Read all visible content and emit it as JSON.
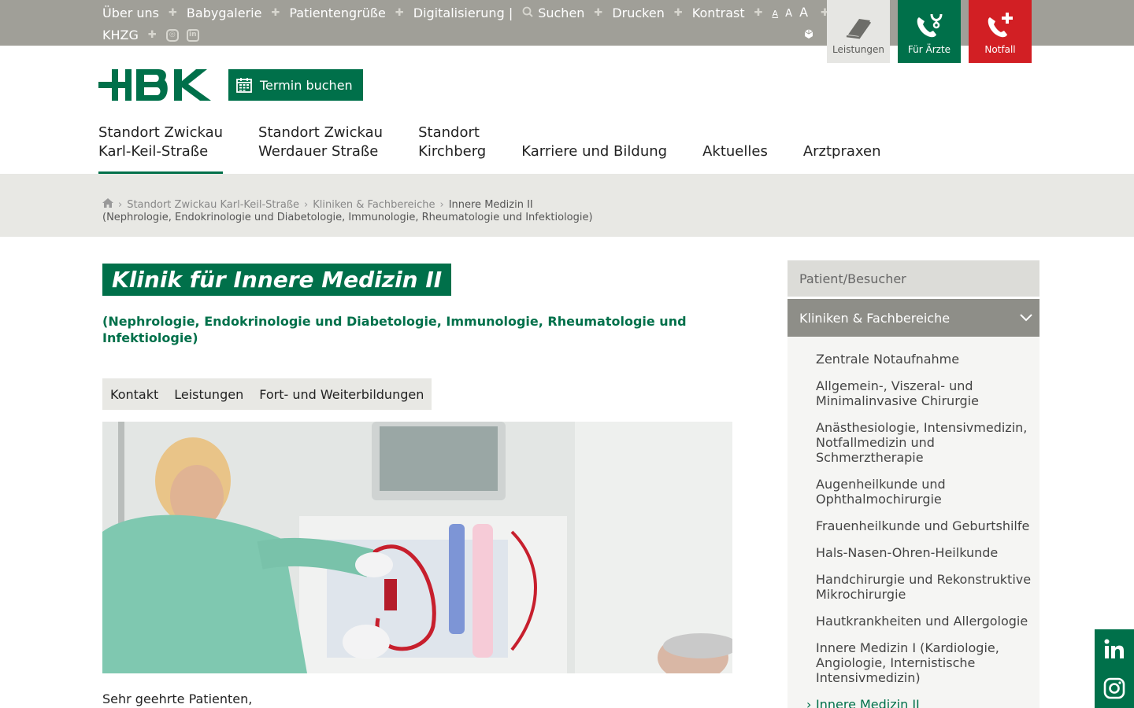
{
  "colors": {
    "brand_green": "#00704a",
    "emergency_red": "#d21f24",
    "topbar_gray": "#a09f98"
  },
  "topbar": {
    "links_row1": [
      "Über uns",
      "Babygalerie",
      "Patientengrüße",
      "Digitalisierung |"
    ],
    "search_label": "Suchen",
    "print_label": "Drucken",
    "contrast_label": "Kontrast",
    "fontsizes": [
      "A",
      "A",
      "A"
    ],
    "link_row2": "KHZG"
  },
  "quick_buttons": {
    "leistungen": "Leistungen",
    "aerzte": "Für Ärzte",
    "notfall": "Notfall"
  },
  "header": {
    "termin_label": "Termin buchen"
  },
  "nav": [
    {
      "line1": "Standort Zwickau",
      "line2": "Karl-Keil-Straße"
    },
    {
      "line1": "Standort Zwickau",
      "line2": "Werdauer Straße"
    },
    {
      "line1": "Standort",
      "line2": "Kirchberg"
    },
    {
      "line1": "Karriere und Bildung"
    },
    {
      "line1": "Aktuelles"
    },
    {
      "line1": "Arztpraxen"
    }
  ],
  "breadcrumb": {
    "items": [
      "Standort Zwickau Karl-Keil-Straße",
      "Kliniken & Fachbereiche"
    ],
    "current": "Innere Medizin II",
    "current_line2": "(Nephrologie, Endokrinologie und Diabetologie, Immunologie, Rheumatologie und Infektiologie)"
  },
  "page": {
    "title": "Klinik für Innere Medizin II",
    "subtitle": "(Nephrologie, Endokrinologie und Diabetologie, Immunologie, Rheumatologie und Infektiologie)",
    "tabs": [
      "Kontakt",
      "Leistungen",
      "Fort- und Weiterbildungen"
    ],
    "greeting": "Sehr geehrte Patienten,"
  },
  "sidebar": {
    "top_label": "Patient/Besucher",
    "active_label": "Kliniken & Fachbereiche",
    "items": [
      "Zentrale Notaufnahme",
      "Allgemein-, Viszeral- und Minimalinvasive Chirurgie",
      "Anästhesiologie, Intensivmedizin, Notfallmedizin und Schmerztherapie",
      "Augenheilkunde und Ophthalmochirurgie",
      "Frauenheilkunde und Geburtshilfe",
      "Hals-Nasen-Ohren-Heilkunde",
      "Handchirurgie und Rekonstruktive Mikrochirurgie",
      "Hautkrankheiten und Allergologie",
      "Innere Medizin I (Kardiologie, Angiologie, Internistische Intensivmedizin)",
      "Innere Medizin II"
    ]
  }
}
